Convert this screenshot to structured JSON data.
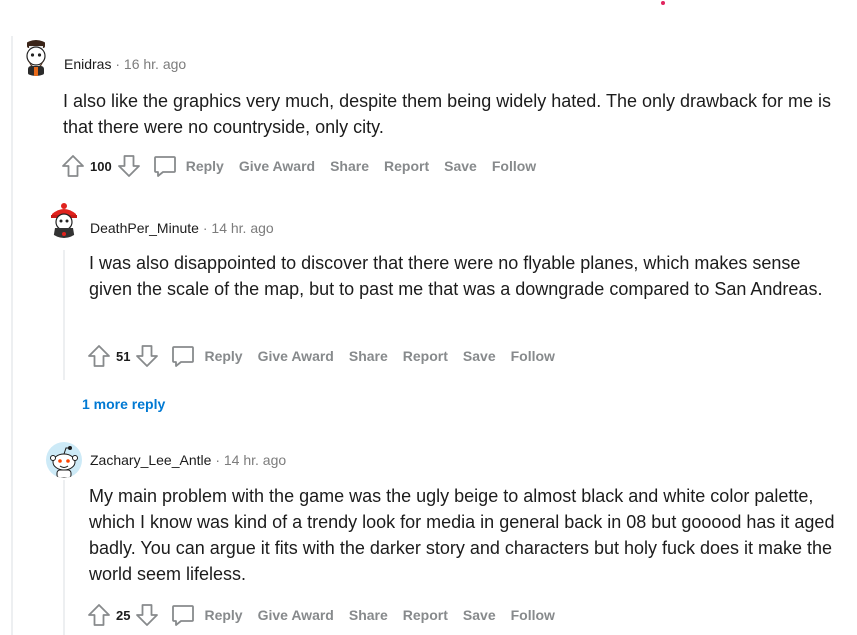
{
  "comments": [
    {
      "user": "Enidras",
      "separator": "·",
      "time": "16 hr. ago",
      "text": "I also like the graphics very much, despite them being widely hated. The only drawback for me is that there were no countryside, only city.",
      "score": "100",
      "actions": {
        "reply": "Reply",
        "award": "Give Award",
        "share": "Share",
        "report": "Report",
        "save": "Save",
        "follow": "Follow"
      }
    },
    {
      "user": "DeathPer_Minute",
      "separator": "·",
      "time": "14 hr. ago",
      "text": "I was also disappointed to discover that there were no flyable planes, which makes sense given the scale of the map, but to past me that was a downgrade compared to San Andreas.",
      "score": "51",
      "actions": {
        "reply": "Reply",
        "award": "Give Award",
        "share": "Share",
        "report": "Report",
        "save": "Save",
        "follow": "Follow"
      },
      "more_replies": "1 more reply"
    },
    {
      "user": "Zachary_Lee_Antle",
      "separator": "·",
      "time": "14 hr. ago",
      "text": "My main problem with the game was the ugly beige to almost black and white color palette, which I know was kind of a trendy look for media in general back in 08 but gooood has it aged badly. You can argue it fits with the darker story and characters but holy fuck does it make the world seem lifeless.",
      "score": "25",
      "actions": {
        "reply": "Reply",
        "award": "Give Award",
        "share": "Share",
        "report": "Report",
        "save": "Save",
        "follow": "Follow"
      }
    }
  ],
  "icons": {
    "upvote": "upvote-arrow-icon",
    "downvote": "downvote-arrow-icon",
    "reply": "speech-bubble-icon"
  },
  "colors": {
    "link": "#0079d3",
    "muted": "#878a8c",
    "thread_line": "#edeff1",
    "notification_dot": "#e0245e"
  }
}
